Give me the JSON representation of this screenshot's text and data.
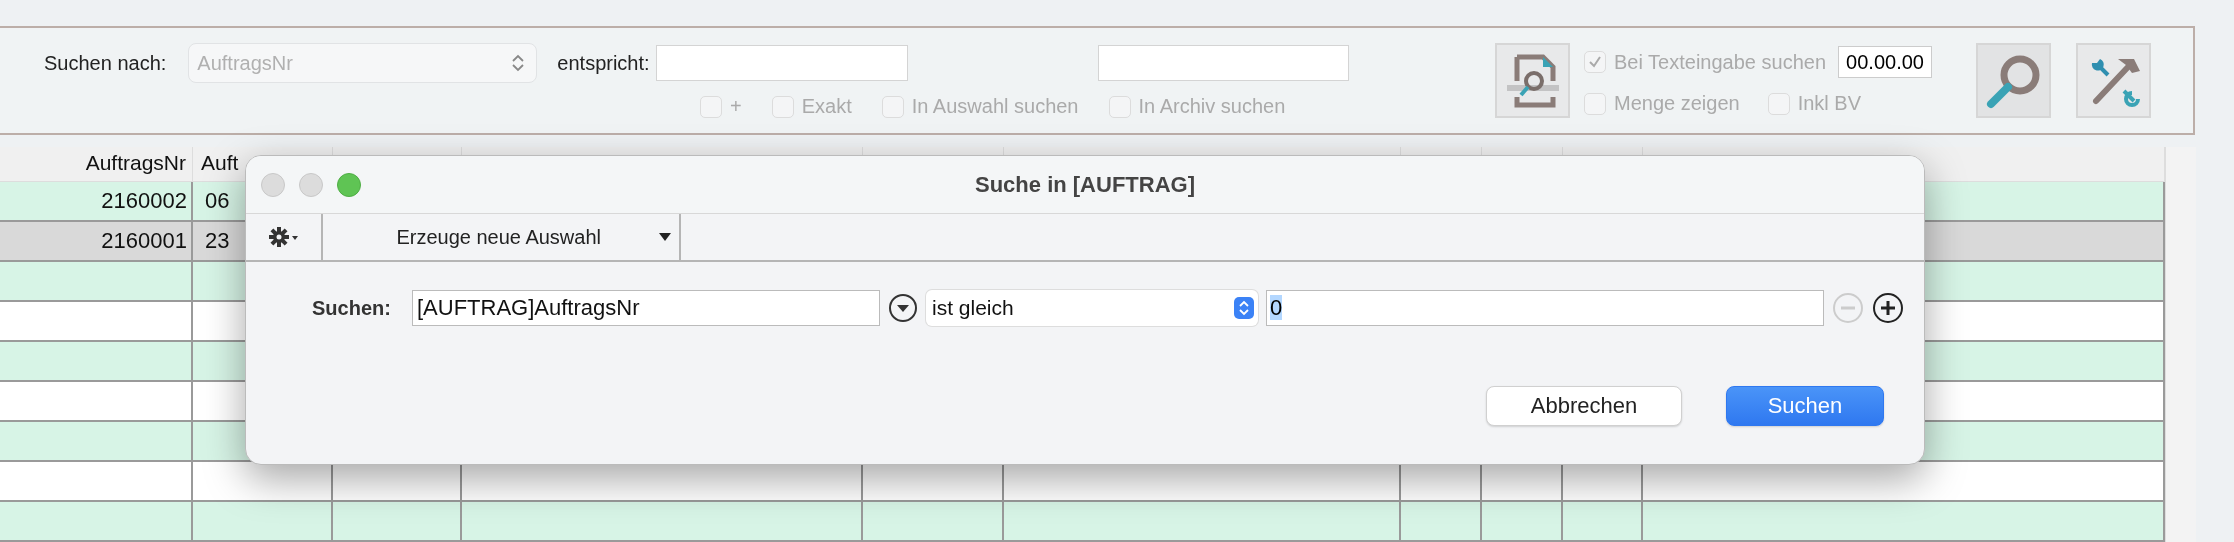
{
  "toolbar": {
    "search_by": {
      "label": "Suchen nach:",
      "value": "AuftragsNr",
      "disabled": true
    },
    "match_label": "entspricht:",
    "options": [
      {
        "label": "+",
        "checked": false,
        "disabled": true
      },
      {
        "label": "Exakt",
        "checked": false,
        "disabled": true
      },
      {
        "label": "In Auswahl suchen",
        "checked": false,
        "disabled": true
      },
      {
        "label": "In Archiv suchen",
        "checked": false,
        "disabled": true
      }
    ],
    "right_options": [
      {
        "label": "Bei Texteingabe suchen",
        "checked": true,
        "disabled": true
      },
      {
        "label": "Menge zeigen",
        "checked": false,
        "disabled": true
      },
      {
        "label": "Inkl BV",
        "checked": false,
        "disabled": true
      }
    ],
    "date": "00.00.00"
  },
  "table": {
    "columns": [
      {
        "label": "AuftragsNr"
      },
      {
        "label": "Auft"
      }
    ],
    "rows": [
      {
        "selected": false,
        "cells": [
          "2160002",
          "06"
        ]
      },
      {
        "selected": true,
        "cells": [
          "2160001",
          "23"
        ]
      },
      {
        "selected": false
      },
      {
        "selected": false
      },
      {
        "selected": false
      },
      {
        "selected": false
      },
      {
        "selected": false
      },
      {
        "selected": false
      },
      {
        "selected": false
      }
    ]
  },
  "dialog": {
    "title": "Suche in [AUFTRAG]",
    "mode": "Erzeuge neue Auswahl",
    "criterion": {
      "label": "Suchen:",
      "field": "[AUFTRAG]AuftragsNr",
      "operator": "ist gleich",
      "value": "0",
      "remove_disabled": true
    },
    "buttons": [
      {
        "label": "Abbrechen",
        "kind": "cancel"
      },
      {
        "label": "Suchen",
        "kind": "default"
      }
    ]
  }
}
